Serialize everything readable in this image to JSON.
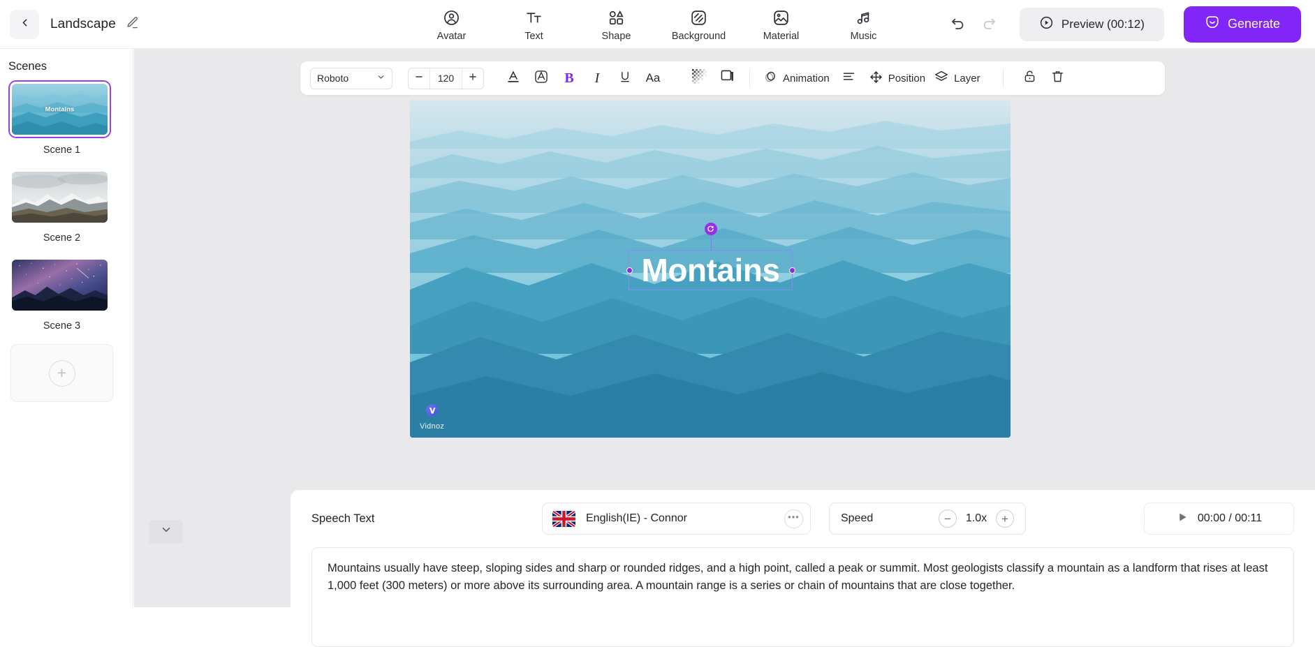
{
  "header": {
    "back_icon": "chevron-left-icon",
    "project_title": "Landscape",
    "edit_icon": "pencil-icon",
    "tools": [
      {
        "icon": "avatar-icon",
        "label": "Avatar"
      },
      {
        "icon": "text-icon",
        "label": "Text"
      },
      {
        "icon": "shape-icon",
        "label": "Shape"
      },
      {
        "icon": "background-icon",
        "label": "Background"
      },
      {
        "icon": "material-icon",
        "label": "Material"
      },
      {
        "icon": "music-icon",
        "label": "Music"
      }
    ],
    "undo_icon": "undo-icon",
    "redo_icon": "redo-icon",
    "preview_label": "Preview (00:12)",
    "preview_icon": "play-circle-icon",
    "generate_label": "Generate",
    "generate_icon": "sparkle-smile-icon",
    "accent_color": "#8226f7"
  },
  "sidebar": {
    "title": "Scenes",
    "scenes": [
      {
        "caption": "Scene 1",
        "overlay_text": "Montains",
        "selected": true
      },
      {
        "caption": "Scene 2",
        "overlay_text": "",
        "selected": false
      },
      {
        "caption": "Scene 3",
        "overlay_text": "",
        "selected": false
      }
    ],
    "add_scene_icon": "plus-icon",
    "selection_color": "#9540e8"
  },
  "format_toolbar": {
    "font_family": "Roboto",
    "font_dropdown_icon": "chevron-down-icon",
    "decrease_icon": "minus-icon",
    "font_size": "120",
    "increase_icon": "plus-icon",
    "buttons": [
      {
        "icon": "text-color-icon",
        "label": "A"
      },
      {
        "icon": "text-outline-icon",
        "label": "A"
      },
      {
        "icon": "bold-icon",
        "label": "B",
        "active": true
      },
      {
        "icon": "italic-icon",
        "label": "I"
      },
      {
        "icon": "underline-icon",
        "label": "U"
      },
      {
        "icon": "text-case-icon",
        "label": "Aa"
      }
    ],
    "opacity_icon": "opacity-checker-icon",
    "shadow_icon": "shadow-square-icon",
    "animation_icon": "animation-icon",
    "animation_label": "Animation",
    "align_icon": "align-left-icon",
    "position_icon": "move-arrows-icon",
    "position_label": "Position",
    "layer_icon": "layers-icon",
    "layer_label": "Layer",
    "lock_icon": "unlock-icon",
    "delete_icon": "trash-icon",
    "active_color": "#8226f7"
  },
  "canvas": {
    "text_element": "Montains",
    "rotate_icon": "rotate-handle-icon",
    "watermark_label": "Vidnoz",
    "watermark_icon": "vidnoz-logo-icon",
    "collapse_icon": "chevron-down-icon"
  },
  "bottom_panel": {
    "speech_text_label": "Speech Text",
    "voice": {
      "flag_icon": "uk-flag-icon",
      "name": "English(IE) - Connor",
      "more_icon": "ellipsis-icon"
    },
    "speed": {
      "label": "Speed",
      "decrease_icon": "minus-circle-icon",
      "value": "1.0x",
      "increase_icon": "plus-circle-icon"
    },
    "player": {
      "play_icon": "play-icon",
      "time": "00:00 / 00:11"
    },
    "script": "Mountains usually have steep, sloping sides and sharp or rounded ridges, and a high point, called a peak or summit. Most geologists classify a mountain as a landform that rises at least 1,000 feet (300 meters) or more above its surrounding area. A mountain range is a series or chain of mountains that are close together."
  }
}
